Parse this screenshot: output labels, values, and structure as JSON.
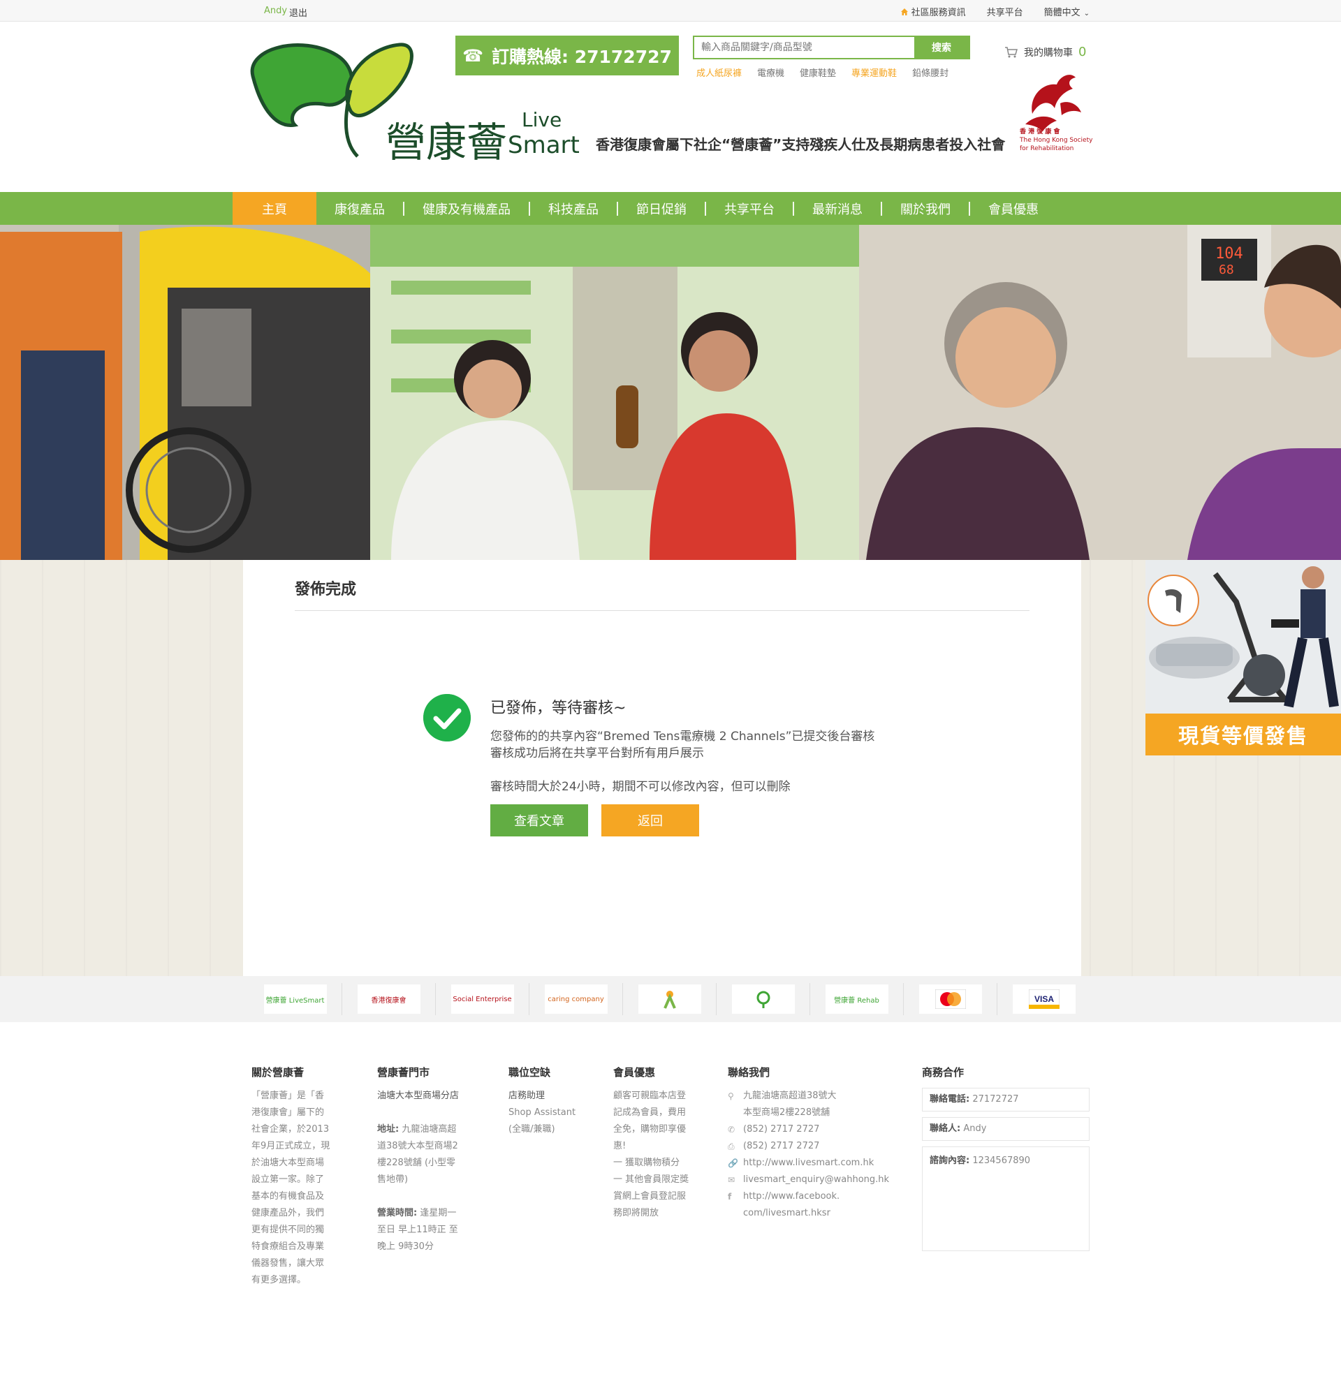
{
  "topbar": {
    "user": "Andy",
    "logout": "退出",
    "links": [
      "社區服務資訊",
      "共享平台",
      "簡體中文"
    ]
  },
  "header": {
    "hotline_label": "訂購熱線: 27172727",
    "search_placeholder": "輸入商品關鍵字/商品型號",
    "search_button": "搜索",
    "hot_tags": [
      {
        "label": "成人紙尿褲",
        "highlight": true
      },
      {
        "label": "電療機",
        "highlight": false
      },
      {
        "label": "健康鞋墊",
        "highlight": false
      },
      {
        "label": "專業運動鞋",
        "highlight": true
      },
      {
        "label": "鉛條腰封",
        "highlight": false
      }
    ],
    "cart_label": "我的購物車",
    "cart_count": "0",
    "slogan": "香港復康會屬下社企“營康薈”支持殘疾人仕及長期病患者投入社會",
    "hkor_name_zh": "香 港 復 康 會",
    "hkor_name_en1": "The Hong Kong Society",
    "hkor_name_en2": "for Rehabilitation",
    "logo_text": "營康薈",
    "logo_sub1": "Live",
    "logo_sub2": "Smart"
  },
  "nav": {
    "items": [
      "主頁",
      "康復產品",
      "健康及有機產品",
      "科技產品",
      "節日促銷",
      "共享平台",
      "最新消息",
      "關於我們",
      "會員優惠"
    ],
    "active_index": 0
  },
  "main": {
    "title": "發佈完成",
    "status_title": "已發佈，等待審核~",
    "line1": "您發佈的的共享內容“Bremed Tens電療機 2 Channels”已提交後台審核",
    "line2": "審核成功后將在共享平台對所有用戶展示",
    "line3": "審核時間大於24小時，期間不可以修改內容，但可以刪除",
    "btn_view": "查看文章",
    "btn_back": "返回"
  },
  "side_ad": {
    "label": "現貨等價發售"
  },
  "partners": [
    "營康薈 LiveSmart",
    "香港復康會",
    "Social Enterprise",
    "caring company",
    "logo",
    "logo",
    "營康薈 Rehab",
    "MasterCard",
    "VISA"
  ],
  "footer": {
    "about": {
      "title": "關於營康薈",
      "text": [
        "「營康薈」是「香",
        "港復康會」屬下的",
        "社會企業，於2013",
        "年9月正式成立，現",
        "於油塘大本型商場",
        "設立第一家。除了",
        "基本的有機食品及",
        "健康產品外，我們",
        "更有提供不同的獨",
        "特食療組合及專業",
        "儀器發售，讓大眾",
        "有更多選擇。"
      ]
    },
    "stores": {
      "title": "營康薈門市",
      "name": "油塘大本型商場分店",
      "addr_label": "地址:",
      "addr": [
        "九龍油塘高超",
        "道38號大本型商場2",
        "樓228號舖 (小型零",
        "售地帶)"
      ],
      "hours_label": "營業時間:",
      "hours": [
        "逢星期一",
        "至日 早上11時正 至",
        "晚上 9時30分"
      ]
    },
    "jobs": {
      "title": "職位空缺",
      "lines": [
        "店務助理",
        "Shop Assistant",
        "(全職/兼職)"
      ]
    },
    "member": {
      "title": "會員優惠",
      "lines": [
        "顧客可親臨本店登",
        "記成為會員，費用",
        "全免，購物即享優",
        "惠!",
        "一 獲取購物積分",
        "一 其他會員限定獎",
        "賞網上會員登記服",
        "務即將開放"
      ]
    },
    "contact": {
      "title": "聯絡我們",
      "address": [
        "九龍油塘高超道38號大",
        "本型商場2樓228號舖"
      ],
      "phone": "(852) 2717  2727",
      "fax": "(852) 2717  2727",
      "web": "http://www.livesmart.com.hk",
      "email": "livesmart_enquiry@wahhong.hk",
      "facebook": [
        "http://www.facebook.",
        "com/livesmart.hksr"
      ]
    },
    "business": {
      "title": "商務合作",
      "phone_label": "聯絡電話:",
      "phone": "27172727",
      "person_label": "聯絡人:",
      "person": "Andy",
      "enquiry_label": "諮詢內容:",
      "enquiry": "1234567890"
    }
  },
  "colors": {
    "brand_green": "#7ab648",
    "accent_orange": "#f5a623",
    "success_green": "#1fb14a",
    "hkor_red": "#b5121b"
  }
}
